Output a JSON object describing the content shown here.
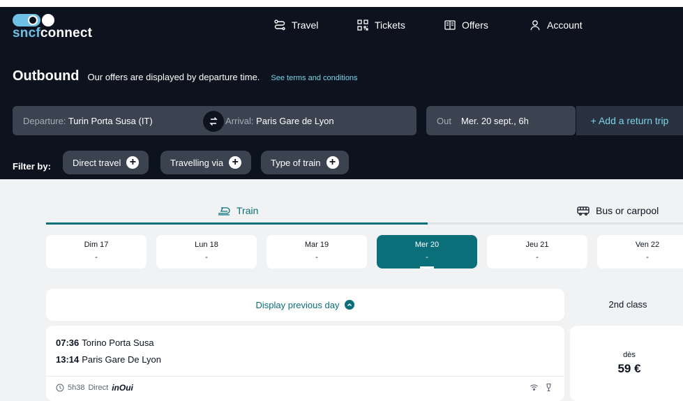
{
  "logo": {
    "part1": "sncf",
    "part2": "connect"
  },
  "nav": [
    {
      "label": "Travel",
      "icon": "route-icon"
    },
    {
      "label": "Tickets",
      "icon": "qr-code-icon"
    },
    {
      "label": "Offers",
      "icon": "book-icon"
    },
    {
      "label": "Account",
      "icon": "user-icon"
    }
  ],
  "heading": {
    "title": "Outbound",
    "subtitle": "Our offers are displayed by departure time.",
    "terms_link": "See terms and conditions"
  },
  "search": {
    "departure_label": "Departure:",
    "departure_value": "Turin Porta Susa (IT)",
    "arrival_label": "Arrival:",
    "arrival_value": "Paris Gare de Lyon",
    "out_label": "Out",
    "out_value": "Mer. 20 sept., 6h",
    "add_return": "+ Add a return trip"
  },
  "filters": {
    "label": "Filter by:",
    "chips": [
      "Direct travel",
      "Travelling via",
      "Type of train"
    ]
  },
  "modes": [
    {
      "label": "Train",
      "icon": "train-icon",
      "active": true
    },
    {
      "label": "Bus or carpool",
      "icon": "bus-icon",
      "active": false
    }
  ],
  "days": [
    {
      "name": "Dim 17",
      "price": "-",
      "active": false
    },
    {
      "name": "Lun 18",
      "price": "-",
      "active": false
    },
    {
      "name": "Mar 19",
      "price": "-",
      "active": false
    },
    {
      "name": "Mer 20",
      "price": "-",
      "active": true
    },
    {
      "name": "Jeu 21",
      "price": "-",
      "active": false
    },
    {
      "name": "Ven 22",
      "price": "-",
      "active": false
    }
  ],
  "results": {
    "prev_day": "Display previous day",
    "class_label": "2nd class",
    "trip": {
      "dep_time": "07:36",
      "dep_station": "Torino Porta Susa",
      "arr_time": "13:14",
      "arr_station": "Paris Gare De Lyon",
      "duration": "5h38",
      "type": "Direct",
      "brand": "inOui",
      "price_prefix": "dès",
      "price": "59 €"
    }
  },
  "colors": {
    "header_bg": "#0c131f",
    "accent": "#0b6f7a",
    "link": "#7dd3e8",
    "chip_bg": "#3b4250"
  }
}
